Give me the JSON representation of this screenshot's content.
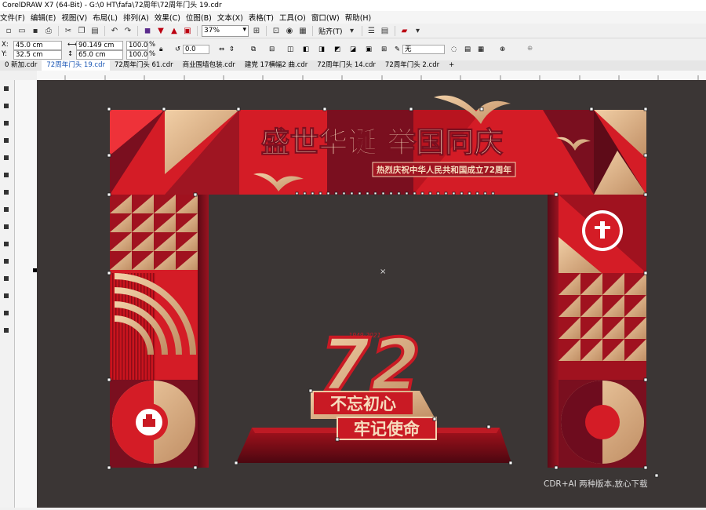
{
  "window": {
    "title": "CorelDRAW X7 (64-Bit) - G:\\0 HT\\fafa\\72周年\\72周年门头 19.cdr"
  },
  "menu": [
    "文件(F)",
    "编辑(E)",
    "视图(V)",
    "布局(L)",
    "排列(A)",
    "效果(C)",
    "位图(B)",
    "文本(X)",
    "表格(T)",
    "工具(O)",
    "窗口(W)",
    "帮助(H)"
  ],
  "toolbar": {
    "zoom": "37%",
    "snap_label": "贴齐(T)"
  },
  "properties": {
    "x": "45.0 cm",
    "y": "32.5 cm",
    "width": "90.149 cm",
    "height": "65.0 cm",
    "scale_w": "100.0",
    "scale_h": "100.0",
    "percent": "%",
    "rotation": "0.0",
    "x_label": "X:",
    "y_label": "Y:",
    "outline": "无"
  },
  "tabs": [
    "0 新加.cdr",
    "72周年门头 19.cdr",
    "72周年门头 61.cdr",
    "商业围墙包装.cdr",
    "建党 17横幅2 曲.cdr",
    "72周年门头 14.cdr",
    "72周年门头 2.cdr",
    "+"
  ],
  "design": {
    "headline": "盛世华诞 举国同庆",
    "subtitle": "热烈庆祝中华人民共和国成立72周年",
    "number": "72",
    "years": "1949-2021",
    "slogan1": "不忘初心",
    "slogan2": "牢记使命"
  },
  "watermark": "CDR+AI 两种版本,放心下载",
  "colors": {
    "red": "#d41c26",
    "dark": "#6e0c1e",
    "gold": "#d9a77a",
    "light": "#f3d3b0"
  }
}
